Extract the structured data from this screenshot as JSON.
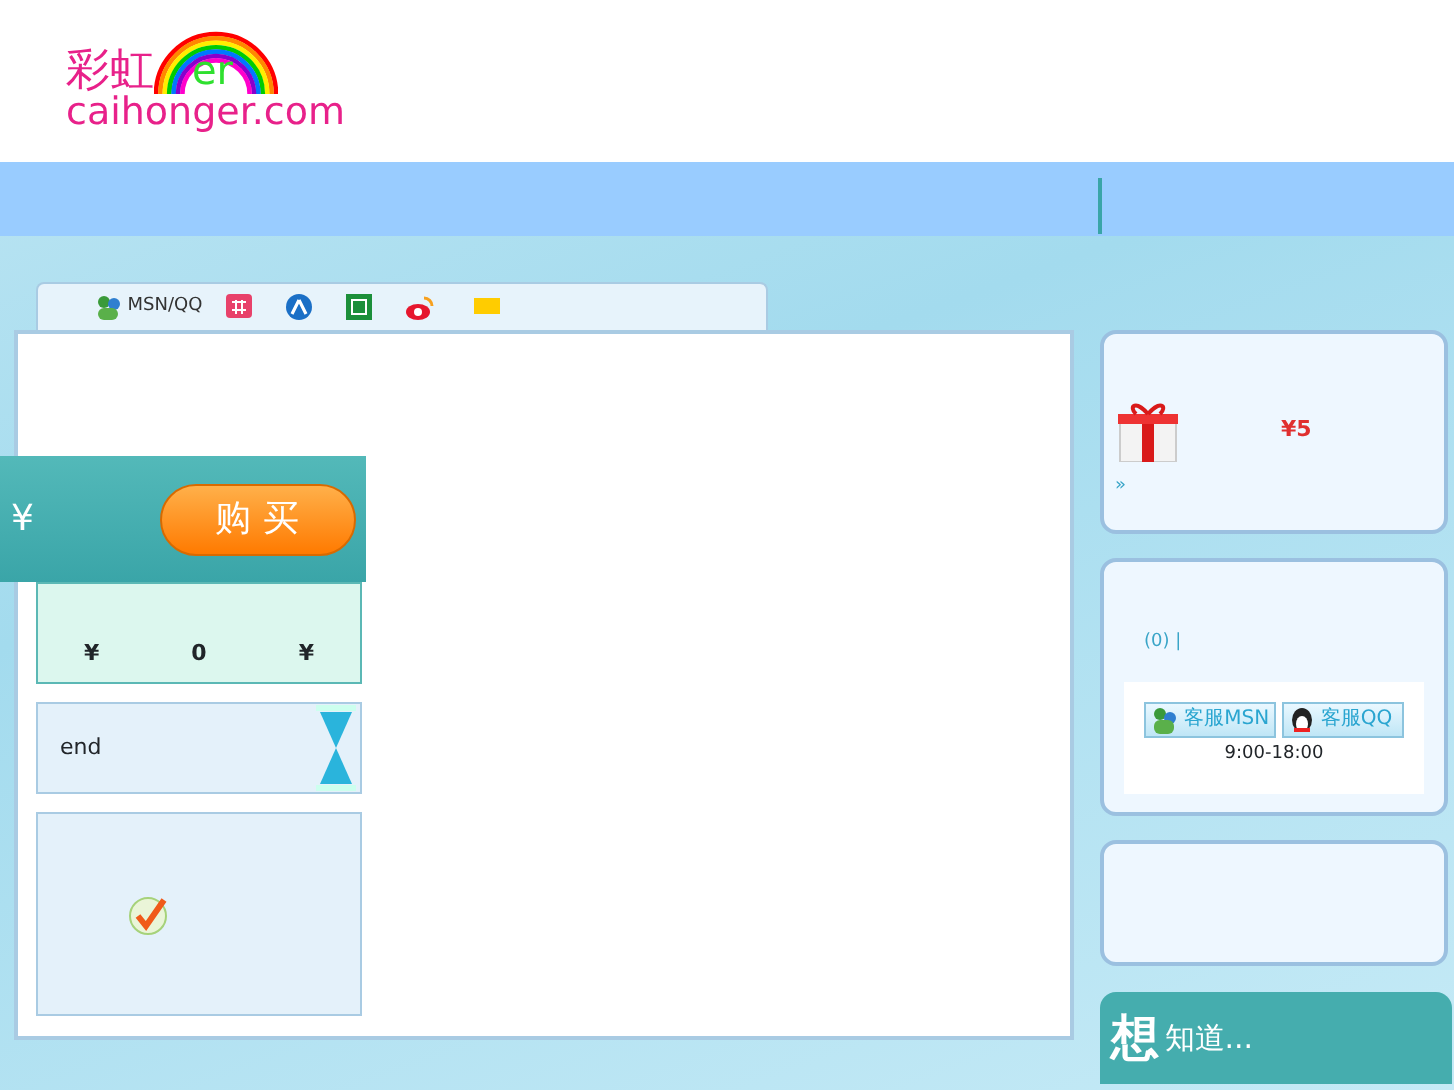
{
  "logo": {
    "chinese": "彩虹",
    "er": "er",
    "domain": "caihonger.com"
  },
  "share_bar": {
    "label": "MSN/QQ"
  },
  "buy_panel": {
    "currency": "¥",
    "button": "购 买"
  },
  "price_row": [
    "¥",
    "0",
    "¥"
  ],
  "countdown": {
    "label": "end"
  },
  "gift_card": {
    "amount": "¥5",
    "more": "»"
  },
  "service_card": {
    "count": "(0) |",
    "buttons": [
      {
        "label": "客服MSN",
        "kind": "msn"
      },
      {
        "label": "客服QQ",
        "kind": "qq"
      }
    ],
    "hours": "9:00-18:00"
  },
  "faq": {
    "big": "想",
    "title": "知道..."
  }
}
